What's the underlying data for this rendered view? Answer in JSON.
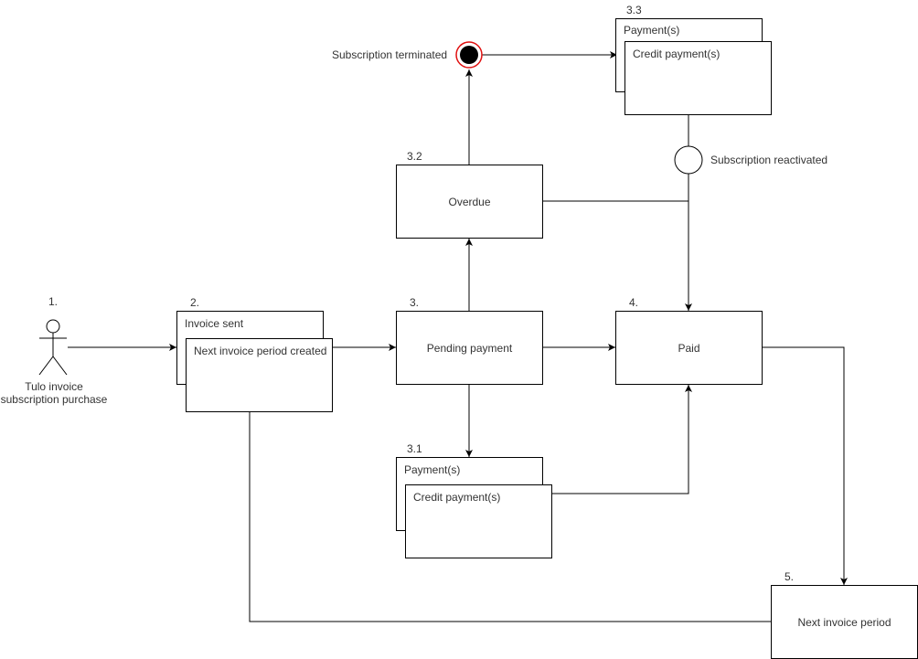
{
  "diagram": {
    "actor": {
      "step": "1.",
      "label_line1": "Tulo invoice",
      "label_line2": "subscription purchase"
    },
    "nodes": {
      "invoice": {
        "step": "2.",
        "back_label": "Invoice sent",
        "front_label": "Next invoice period created"
      },
      "pending": {
        "step": "3.",
        "label": "Pending payment"
      },
      "payments_3_1": {
        "step": "3.1",
        "back_label": "Payment(s)",
        "front_label": "Credit payment(s)"
      },
      "overdue": {
        "step": "3.2",
        "label": "Overdue"
      },
      "payments_3_3": {
        "step": "3.3",
        "back_label": "Payment(s)",
        "front_label": "Credit payment(s)"
      },
      "paid": {
        "step": "4.",
        "label": "Paid"
      },
      "next_period": {
        "step": "5.",
        "label": "Next invoice period"
      }
    },
    "events": {
      "terminated": {
        "label": "Subscription terminated",
        "ring_color": "#e01010",
        "fill_color": "#000000"
      },
      "reactivated": {
        "label": "Subscription reactivated"
      }
    }
  }
}
